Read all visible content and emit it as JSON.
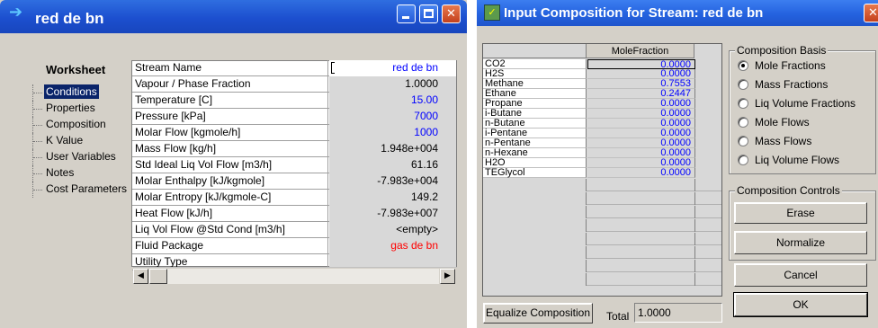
{
  "window1": {
    "title": "red de bn",
    "nav_heading": "Worksheet",
    "nav_items": [
      {
        "label": "Conditions",
        "selected": true
      },
      {
        "label": "Properties"
      },
      {
        "label": "Composition"
      },
      {
        "label": "K Value"
      },
      {
        "label": "User Variables"
      },
      {
        "label": "Notes"
      },
      {
        "label": "Cost Parameters"
      }
    ],
    "rows": [
      {
        "name": "Stream Name",
        "value": "red de bn"
      },
      {
        "name": "Vapour / Phase Fraction",
        "value": "1.0000"
      },
      {
        "name": "Temperature [C]",
        "value": "15.00"
      },
      {
        "name": "Pressure [kPa]",
        "value": "7000"
      },
      {
        "name": "Molar Flow [kgmole/h]",
        "value": "1000"
      },
      {
        "name": "Mass Flow [kg/h]",
        "value": "1.948e+004"
      },
      {
        "name": "Std Ideal Liq Vol Flow [m3/h]",
        "value": "61.16"
      },
      {
        "name": "Molar Enthalpy [kJ/kgmole]",
        "value": "-7.983e+004"
      },
      {
        "name": "Molar Entropy [kJ/kgmole-C]",
        "value": "149.2"
      },
      {
        "name": "Heat Flow [kJ/h]",
        "value": "-7.983e+007"
      },
      {
        "name": "Liq Vol Flow @Std Cond [m3/h]",
        "value": "<empty>"
      },
      {
        "name": "Fluid Package",
        "value": "gas de bn"
      },
      {
        "name": "Utility Type",
        "value": ""
      }
    ],
    "colors": {
      "specified": "#0000ff",
      "package": "#ff0000"
    }
  },
  "window2": {
    "title": "Input Composition for Stream: red de bn",
    "column_header": "MoleFraction",
    "components": [
      {
        "name": "CO2",
        "value": "0.0000"
      },
      {
        "name": "H2S",
        "value": "0.0000"
      },
      {
        "name": "Methane",
        "value": "0.7553"
      },
      {
        "name": "Ethane",
        "value": "0.2447"
      },
      {
        "name": "Propane",
        "value": "0.0000"
      },
      {
        "name": "i-Butane",
        "value": "0.0000"
      },
      {
        "name": "n-Butane",
        "value": "0.0000"
      },
      {
        "name": "i-Pentane",
        "value": "0.0000"
      },
      {
        "name": "n-Pentane",
        "value": "0.0000"
      },
      {
        "name": "n-Hexane",
        "value": "0.0000"
      },
      {
        "name": "H2O",
        "value": "0.0000"
      },
      {
        "name": "TEGlycol",
        "value": "0.0000"
      }
    ],
    "basis_title": "Composition Basis",
    "basis_options": [
      {
        "label": "Mole Fractions",
        "selected": true
      },
      {
        "label": "Mass Fractions"
      },
      {
        "label": "Liq Volume Fractions"
      },
      {
        "label": "Mole Flows"
      },
      {
        "label": "Mass Flows"
      },
      {
        "label": "Liq Volume Flows"
      }
    ],
    "controls_title": "Composition Controls",
    "buttons": {
      "erase": "Erase",
      "normalize": "Normalize",
      "cancel": "Cancel",
      "ok": "OK",
      "equalize": "Equalize Composition"
    },
    "total_label": "Total",
    "total_value": "1.0000"
  }
}
